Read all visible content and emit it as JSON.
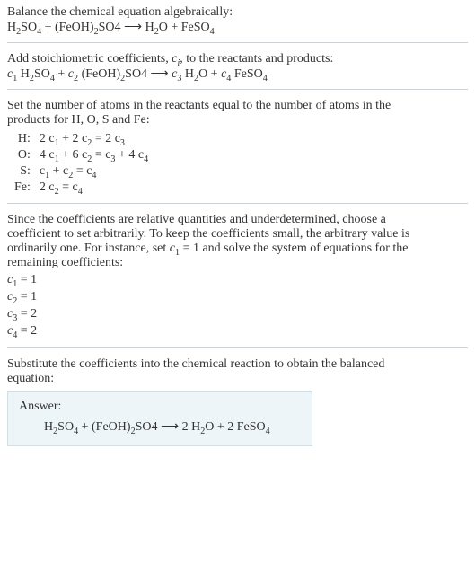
{
  "intro": {
    "line1": "Balance the chemical equation algebraically:",
    "reaction_lhs1": "H",
    "reaction_lhs1_s": "2",
    "reaction_lhs2": "SO",
    "reaction_lhs2_s": "4",
    "plus1": " + (FeOH)",
    "feoh_s": "2",
    "so4_2": "SO4  ⟶  H",
    "h2o_s": "2",
    "h2o_txt": "O + FeSO",
    "feso_s": "4"
  },
  "step_add": {
    "text_a": "Add stoichiometric coefficients, ",
    "ci": "c",
    "ci_sub": "i",
    "text_b": ", to the reactants and products:",
    "c1": "c",
    "s1": "1",
    "h": " H",
    "h2": "2",
    "so4": "SO",
    "so4s": "4",
    "plus": " + ",
    "c2": "c",
    "s2": "2",
    "feoh": " (FeOH)",
    "feohs": "2",
    "so4_2": "SO4  ⟶  ",
    "c3": "c",
    "s3": "3",
    "h2o": " H",
    "h2o_s": "2",
    "o": "O + ",
    "c4": "c",
    "s4": "4",
    "feso4": " FeSO",
    "fesos": "4"
  },
  "set_atoms": {
    "line1": "Set the number of atoms in the reactants equal to the number of atoms in the",
    "line2": "products for H, O, S and Fe:"
  },
  "atom_eqs": [
    {
      "el": "H:",
      "eq_a": "2 c",
      "eq_as": "1",
      "eq_b": " + 2 c",
      "eq_bs": "2",
      "eq_c": " = 2 c",
      "eq_cs": "3"
    },
    {
      "el": "O:",
      "eq_a": "4 c",
      "eq_as": "1",
      "eq_b": " + 6 c",
      "eq_bs": "2",
      "eq_c": " = c",
      "eq_cs": "3",
      "eq_d": " + 4 c",
      "eq_ds": "4"
    },
    {
      "el": "S:",
      "eq_a": "c",
      "eq_as": "1",
      "eq_b": " + c",
      "eq_bs": "2",
      "eq_c": " = c",
      "eq_cs": "4"
    },
    {
      "el": "Fe:",
      "eq_a": "2 c",
      "eq_as": "2",
      "eq_b": " = c",
      "eq_bs": "4"
    }
  ],
  "underdet": {
    "l1": "Since the coefficients are relative quantities and underdetermined, choose a",
    "l2": "coefficient to set arbitrarily. To keep the coefficients small, the arbitrary value is",
    "l3_a": "ordinarily one. For instance, set ",
    "c1": "c",
    "c1s": "1",
    "l3_b": " = 1 and solve the system of equations for the",
    "l4": "remaining coefficients:"
  },
  "solutions": [
    {
      "c": "c",
      "s": "1",
      "v": " = 1"
    },
    {
      "c": "c",
      "s": "2",
      "v": " = 1"
    },
    {
      "c": "c",
      "s": "3",
      "v": " = 2"
    },
    {
      "c": "c",
      "s": "4",
      "v": " = 2"
    }
  ],
  "subst": {
    "l1": "Substitute the coefficients into the chemical reaction to obtain the balanced",
    "l2": "equation:"
  },
  "answer": {
    "title": "Answer:",
    "p1": "H",
    "p1s": "2",
    "p2": "SO",
    "p2s": "4",
    "p3": " + (FeOH)",
    "p3s": "2",
    "p4": "SO4  ⟶  2 H",
    "p4s": "2",
    "p5": "O + 2 FeSO",
    "p5s": "4"
  }
}
